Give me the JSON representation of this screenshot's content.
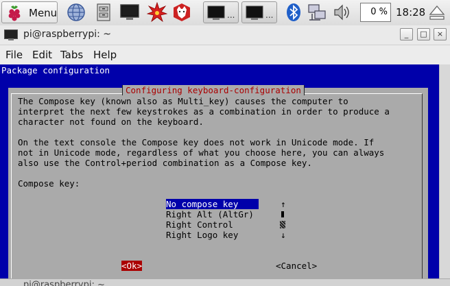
{
  "panel": {
    "menu_label": "Menu",
    "icons": [
      "raspberry-icon",
      "globe-icon",
      "file-manager-icon",
      "terminal-icon",
      "burst-icon",
      "wolfram-icon",
      "terminal-window-icon",
      "bluetooth-icon",
      "network-icon",
      "volume-icon",
      "eject-icon"
    ],
    "task_dots_1": "...",
    "task_dots_2": "...",
    "cpu_label": "0 %",
    "clock": "18:28"
  },
  "window": {
    "title": "pi@raspberrypi: ~",
    "min_label": "_",
    "max_label": "□",
    "close_label": "×",
    "menus": [
      "File",
      "Edit",
      "Tabs",
      "Help"
    ]
  },
  "terminal": {
    "header": "Package configuration",
    "dialog_title": "Configuring keyboard-configuration",
    "paragraph1": [
      "The Compose key (known also as Multi_key) causes the computer to",
      "interpret the next few keystrokes as a combination in order to produce a",
      "character not found on the keyboard."
    ],
    "paragraph2": [
      "On the text console the Compose key does not work in Unicode mode. If",
      "not in Unicode mode, regardless of what you choose here, you can always",
      "also use the Control+period combination as a Compose key."
    ],
    "prompt": "Compose key:",
    "options": [
      "No compose key    ",
      "Right Alt (AltGr)",
      "Right Control",
      "Right Logo key"
    ],
    "selected_index": 0,
    "scroll_up": "↑",
    "scroll_down": "↓",
    "ok_label": "<Ok>",
    "cancel_label": "<Cancel>"
  },
  "taskbar_bottom": {
    "label": "pi@raspberrypi: ~"
  },
  "colors": {
    "terminal_bg": "#0000aa",
    "dialog_bg": "#aaaaaa",
    "title_red": "#aa0000"
  }
}
